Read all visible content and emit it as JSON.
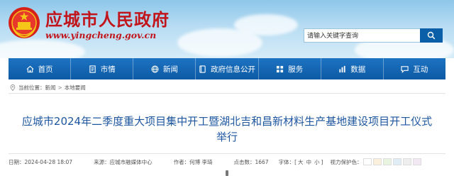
{
  "header": {
    "site_title": "应城市人民政府",
    "site_url": "www.yingcheng.gov.cn",
    "emblem": "national-emblem",
    "title_color": "#c2141b"
  },
  "search": {
    "placeholder": "请输入关键字查询",
    "button_icon": "search-icon"
  },
  "nav": {
    "items": [
      {
        "label": "首页",
        "icon": "home-icon"
      },
      {
        "label": "市情",
        "icon": "document-icon"
      },
      {
        "label": "新闻",
        "icon": "globe-icon"
      },
      {
        "label": "政府信息公开",
        "icon": "book-icon"
      },
      {
        "label": "服务",
        "icon": "grid-icon"
      },
      {
        "label": "数据",
        "icon": "chart-icon"
      },
      {
        "label": "互动",
        "icon": "chat-icon"
      }
    ],
    "bg_color": "#0d5aa5"
  },
  "breadcrumb": {
    "prefix": "当前位置：",
    "items": [
      "新闻",
      "本地要闻"
    ],
    "separator": ">"
  },
  "article": {
    "title": "应城市2024年二季度重大项目集中开工暨湖北吉和昌新材料生产基地建设项目开工仪式举行",
    "title_color": "#1e56a0"
  },
  "meta": {
    "date": "日期：2024-04-28 18:07",
    "source": "来源：应城市融媒体中心",
    "author": "作者：何博 李琦",
    "views": "点击数：1667",
    "font_label": "字体：[",
    "font_sizes": [
      "大",
      "中",
      "小"
    ],
    "font_close": "]",
    "vision_label": "视力保护色：",
    "vision_colors": [
      "#ffffff",
      "#faf0dc",
      "#e8f3e0",
      "#e0ecf6",
      "#eeeeee",
      "#f1e8f4"
    ]
  }
}
